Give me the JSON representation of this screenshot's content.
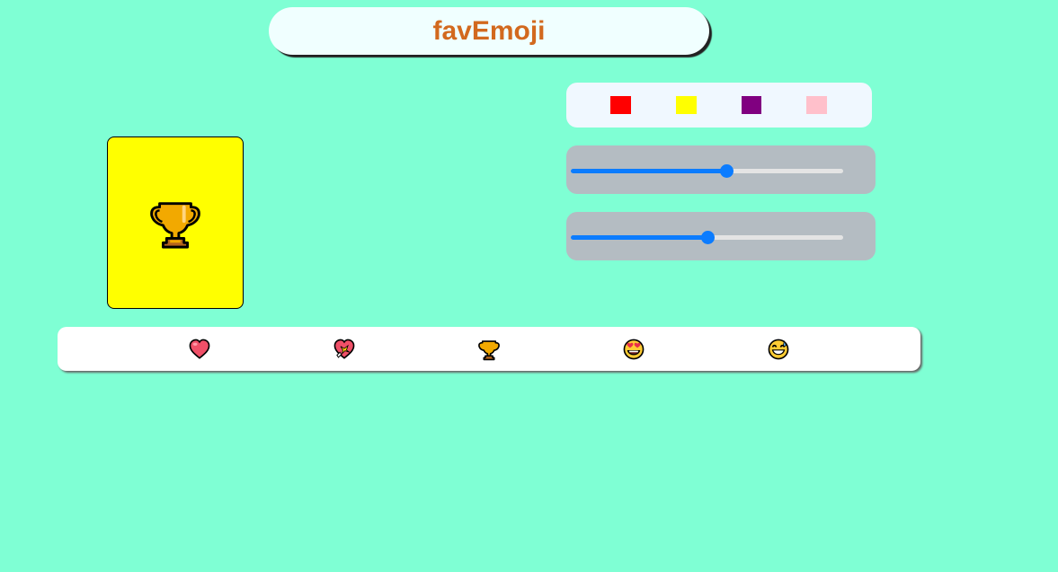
{
  "header": {
    "title": "favEmoji"
  },
  "color_palette": {
    "swatches": [
      {
        "name": "red",
        "color": "#ff0000"
      },
      {
        "name": "yellow",
        "color": "#ffff00"
      },
      {
        "name": "purple",
        "color": "#800080"
      },
      {
        "name": "pink",
        "color": "#ffc0cb"
      }
    ]
  },
  "sliders": [
    {
      "name": "slider-1",
      "value_percent": 57
    },
    {
      "name": "slider-2",
      "value_percent": 50
    }
  ],
  "preview": {
    "background_color": "#ffff00",
    "emoji_icon": "trophy-icon"
  },
  "emoji_bar": {
    "options": [
      {
        "icon": "heart-icon"
      },
      {
        "icon": "heart-with-ribbon-icon"
      },
      {
        "icon": "trophy-icon"
      },
      {
        "icon": "heart-eyes-face-icon"
      },
      {
        "icon": "grinning-sweat-face-icon"
      }
    ]
  }
}
